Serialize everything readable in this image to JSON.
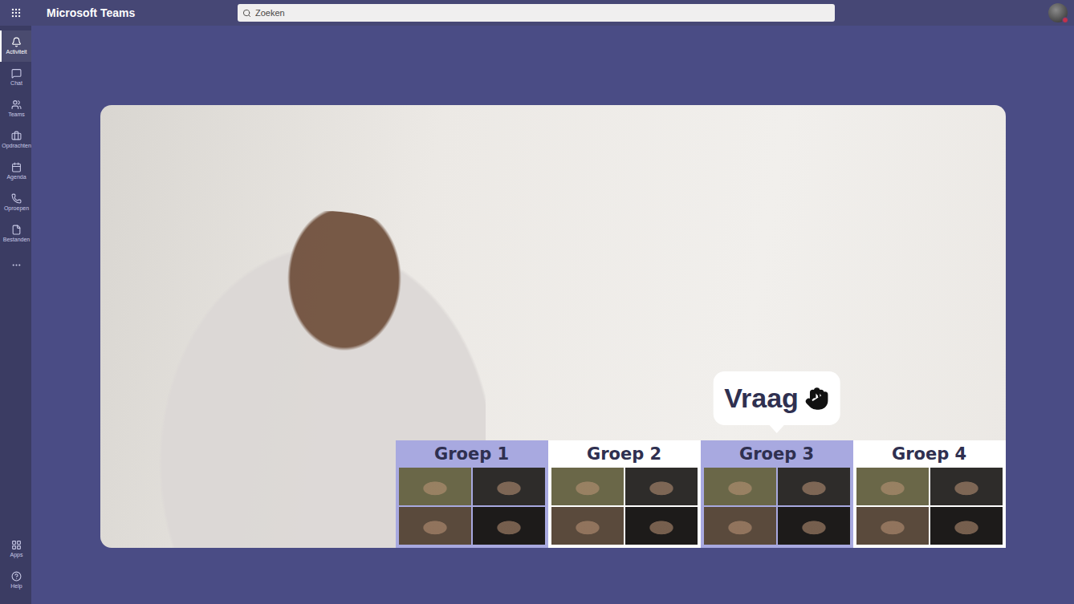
{
  "window": {
    "title": "Microsoft Teams"
  },
  "search": {
    "placeholder": "Zoeken"
  },
  "rail": {
    "items": [
      {
        "label": "Activiteit",
        "selected": true
      },
      {
        "label": "Chat",
        "selected": false
      },
      {
        "label": "Teams",
        "selected": false
      },
      {
        "label": "Opdrachten",
        "selected": false
      },
      {
        "label": "Agenda",
        "selected": false
      },
      {
        "label": "Oproepen",
        "selected": false
      },
      {
        "label": "Bestanden",
        "selected": false
      }
    ],
    "bottom_items": [
      {
        "label": "Apps",
        "selected": false
      },
      {
        "label": "Help",
        "selected": false
      }
    ]
  },
  "question": {
    "label": "Vraag"
  },
  "groups": [
    {
      "name": "Groep 1",
      "highlighted": true,
      "raised_hand": false,
      "tiles": 4
    },
    {
      "name": "Groep 2",
      "highlighted": false,
      "raised_hand": false,
      "tiles": 4
    },
    {
      "name": "Groep 3",
      "highlighted": true,
      "raised_hand": true,
      "tiles": 4
    },
    {
      "name": "Groep 4",
      "highlighted": false,
      "raised_hand": false,
      "tiles": 4
    }
  ]
}
